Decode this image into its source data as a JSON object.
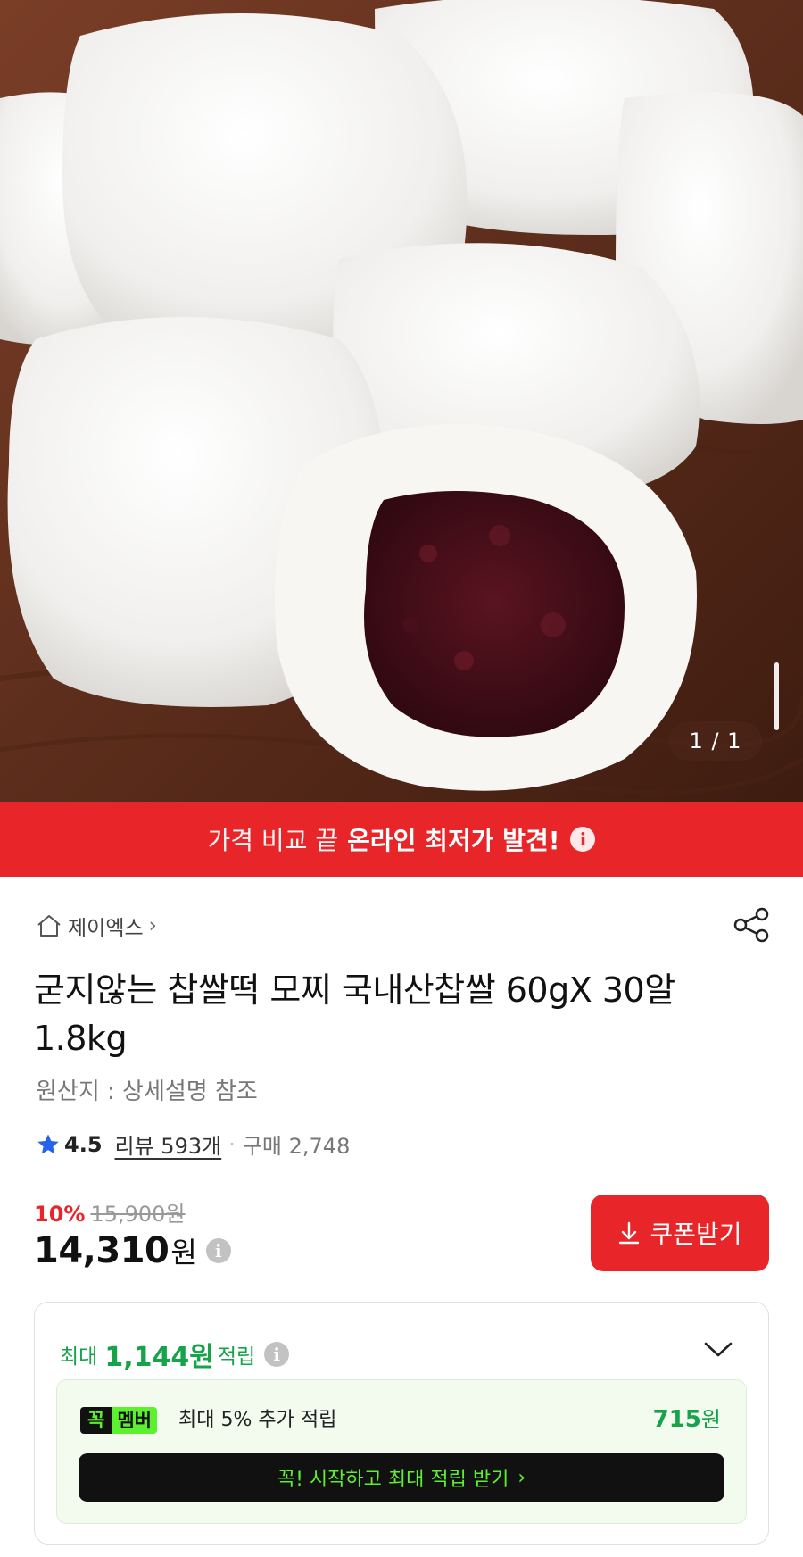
{
  "gallery": {
    "page_counter": "1 / 1"
  },
  "promo_banner": {
    "text_light": "가격 비교 끝",
    "text_strong": "온라인 최저가 발견!",
    "info_icon": "info-icon"
  },
  "seller": {
    "name": "제이엑스",
    "home_icon": "home-icon",
    "chevron": "›",
    "share_icon": "share-icon"
  },
  "product": {
    "title": "굳지않는 찹쌀떡 모찌 국내산찹쌀 60gX 30알 1.8kg",
    "origin": "원산지 : 상세설명 참조"
  },
  "rating": {
    "score": "4.5",
    "reviews": "리뷰 593개",
    "separator": "·",
    "purchases": "구매 2,748"
  },
  "price": {
    "discount_rate": "10%",
    "original": "15,900원",
    "current": "14,310",
    "currency": "원"
  },
  "coupon": {
    "label": "쿠폰받기",
    "icon": "download-arrow-icon"
  },
  "reward": {
    "prefix": "최대",
    "amount": "1,144원",
    "suffix": "적립",
    "member_badge_1": "꼭",
    "member_badge_2": "멤버",
    "member_text": "최대 5% 추가 적립",
    "member_amount": "715",
    "member_currency": "원",
    "start_button": "꼭! 시작하고 최대 적립 받기",
    "start_arrow": "›"
  },
  "colors": {
    "brand_red": "#e8262a",
    "reward_green": "#16a34a",
    "member_lime": "#5df02f"
  }
}
